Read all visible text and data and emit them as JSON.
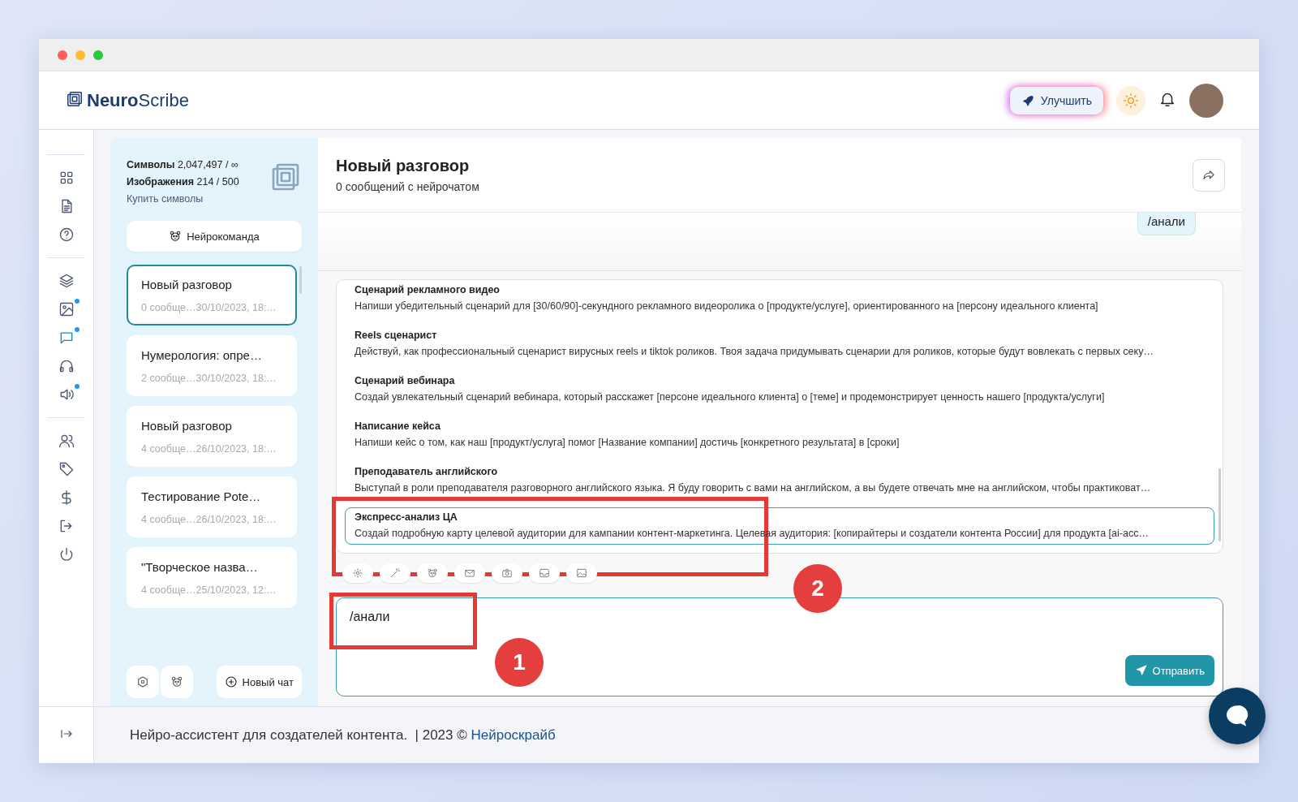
{
  "header": {
    "logo": "**Neuro**Scribe",
    "upgrade_button": "Улучшить"
  },
  "nav_groups": [
    {
      "items": [
        {
          "selected": false,
          "badge": false
        },
        {
          "selected": false,
          "badge": false
        },
        {
          "selected": false,
          "badge": false
        }
      ]
    },
    {
      "items": [
        {
          "selected": false,
          "badge": false
        },
        {
          "selected": false,
          "badge": true
        },
        {
          "selected": true,
          "badge": true
        },
        {
          "selected": false,
          "badge": false
        },
        {
          "selected": false,
          "badge": true
        }
      ]
    },
    {
      "items": [
        {
          "selected": false,
          "badge": false
        },
        {
          "selected": false,
          "badge": false
        },
        {
          "selected": false,
          "badge": false
        },
        {
          "selected": false,
          "badge": false
        },
        {
          "selected": false,
          "badge": false
        }
      ]
    }
  ],
  "side_panel": {
    "usage": [
      "**Символы** 2,047,497 / ∞",
      "**Изображения** 214 / 500"
    ],
    "buy_link": "Купить символы",
    "team_button": "Нейрокоманда",
    "chats": [
      {
        "title": "Новый разговор",
        "meta": "0 сообще…30/10/2023, 18:…",
        "selected": true
      },
      {
        "title": "Нумерология: опре…",
        "meta": "2 сообще…30/10/2023, 18:…",
        "selected": false
      },
      {
        "title": "Новый разговор",
        "meta": "4 сообще…26/10/2023, 18:…",
        "selected": false
      },
      {
        "title": "Тестирование Pote…",
        "meta": "4 сообще…26/10/2023, 18:…",
        "selected": false
      },
      {
        "title": "\"Творческое назва…",
        "meta": "4 сообще…25/10/2023, 12:…",
        "selected": false
      }
    ],
    "new_chat_button": "Новый чат"
  },
  "chat": {
    "title": "Новый разговор",
    "subtitle": "0 сообщений с нейрочатом",
    "messages": [
      {
        "text": "/анали"
      }
    ],
    "prompts": [
      {
        "title": "Сценарий рекламного видео",
        "text": "Напиши убедительный сценарий для [30/60/90]-секундного рекламного видеоролика о [продукте/услуге], ориентированного на [персону идеального клиента]",
        "selected": false
      },
      {
        "title": "Reels сценарист",
        "text": "Действуй, как профессиональный сценарист вирусных reels и tiktok роликов. Твоя задача придумывать сценарии для роликов, которые будут вовлекать с первых секу…",
        "selected": false
      },
      {
        "title": "Сценарий вебинара",
        "text": "Создай увлекательный сценарий вебинара, который расскажет [персоне идеального клиента] о [теме] и продемонстрирует ценность нашего [продукта/услуги]",
        "selected": false
      },
      {
        "title": "Написание кейса",
        "text": "Напиши кейс о том, как наш [продукт/услуга] помог [Название компании] достичь [конкретного результата] в [сроки]",
        "selected": false
      },
      {
        "title": "Преподаватель английского",
        "text": "Выступай в роли преподавателя разговорного английского языка. Я буду говорить с вами на английском, а вы будете отвечать мне на английском, чтобы практиковат…",
        "selected": false
      },
      {
        "title": "Экспресс-анализ ЦА",
        "text": "Создай подробную карту целевой аудитории для кампании контент-маркетинга. Целевая аудитория: [копирайтеры и создатели контента России] для продукта [ai-асс…",
        "selected": true
      }
    ],
    "input_value": "/анали",
    "send_button": "Отправить"
  },
  "footer": {
    "text": "Нейро-ассистент для создателей контента.  | 2023 © ",
    "link": "Нейроскрайб"
  },
  "annotations": [
    {
      "label": "1"
    },
    {
      "label": "2"
    }
  ]
}
